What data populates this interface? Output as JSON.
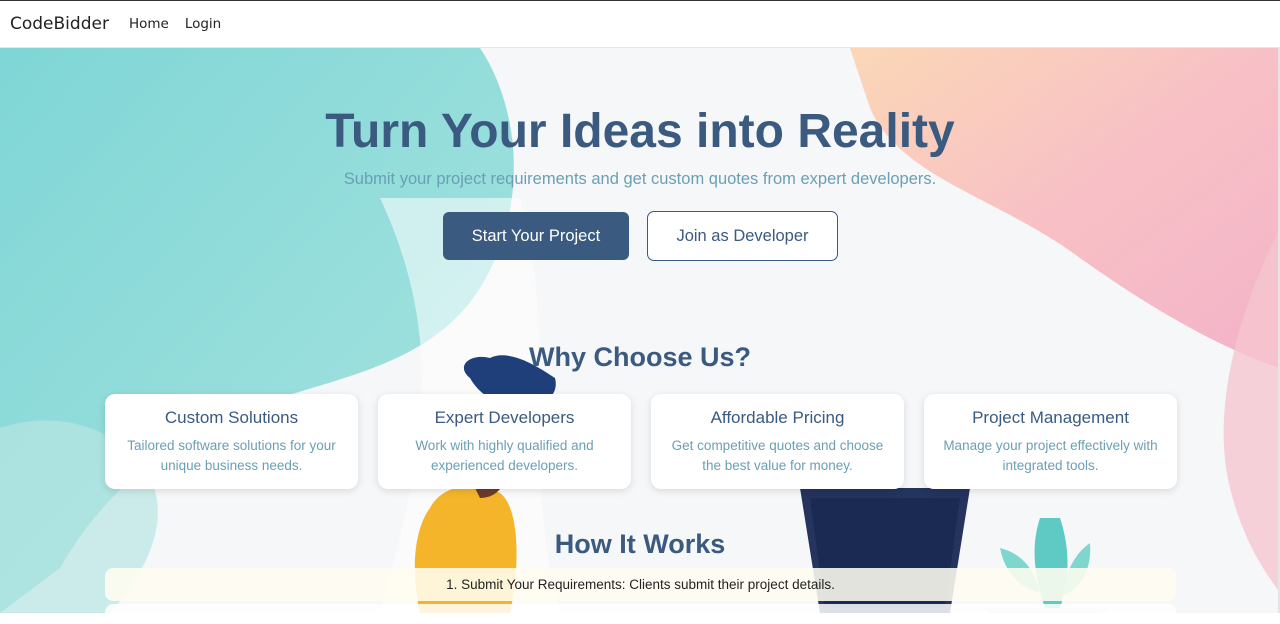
{
  "nav": {
    "brand": "CodeBidder",
    "links": [
      "Home",
      "Login"
    ]
  },
  "hero": {
    "title": "Turn Your Ideas into Reality",
    "subtitle": "Submit your project requirements and get custom quotes from expert developers.",
    "primary_button": "Start Your Project",
    "secondary_button": "Join as Developer"
  },
  "why": {
    "title": "Why Choose Us?",
    "cards": [
      {
        "title": "Custom Solutions",
        "text": "Tailored software solutions for your unique business needs."
      },
      {
        "title": "Expert Developers",
        "text": "Work with highly qualified and experienced developers."
      },
      {
        "title": "Affordable Pricing",
        "text": "Get competitive quotes and choose the best value for money."
      },
      {
        "title": "Project Management",
        "text": "Manage your project effectively with integrated tools."
      }
    ]
  },
  "how": {
    "title": "How It Works",
    "steps": [
      "1. Submit Your Requirements: Clients submit their project details."
    ]
  },
  "colors": {
    "primary": "#3a5a80",
    "accent_text": "#6a9fb5",
    "teal_blob": "#8fdcdc",
    "pink_blob": "#f7b9c6",
    "peach_blob": "#fbd3b6"
  }
}
